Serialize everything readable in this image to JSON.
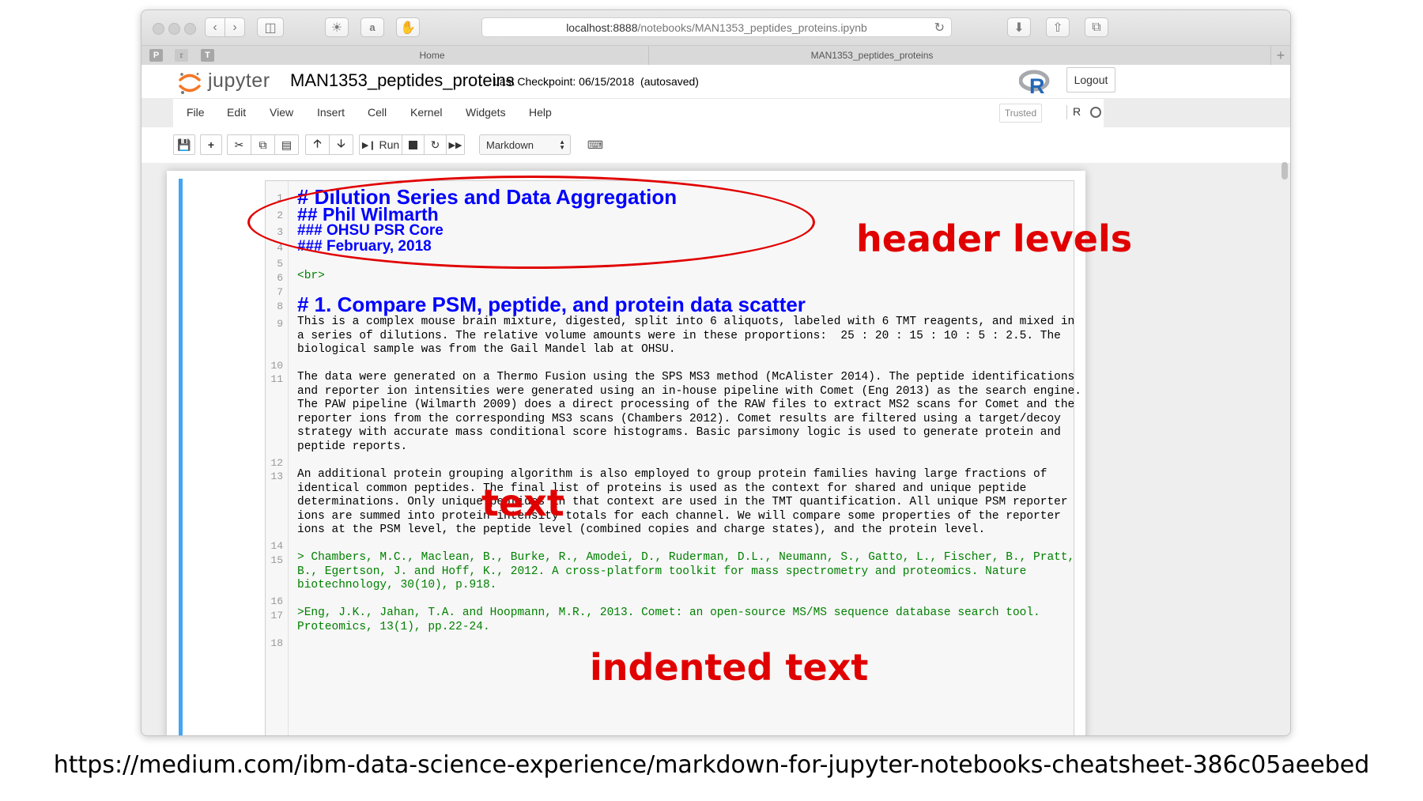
{
  "browser": {
    "url_host": "localhost:8888",
    "url_path": "/notebooks/MAN1353_peptides_proteins.ipynb",
    "tabs": [
      {
        "label": "Home"
      },
      {
        "label": "MAN1353_peptides_proteins"
      }
    ],
    "favorites": [
      "P",
      "T"
    ]
  },
  "jupyter": {
    "logo_text": "jupyter",
    "notebook_name": "MAN1353_peptides_proteins",
    "checkpoint": "Last Checkpoint: 06/15/2018",
    "autosave": "(autosaved)",
    "logout_label": "Logout",
    "kernel_logo": "R",
    "trusted_label": "Trusted",
    "kernel_indicator": "R"
  },
  "menu": [
    "File",
    "Edit",
    "View",
    "Insert",
    "Cell",
    "Kernel",
    "Widgets",
    "Help"
  ],
  "toolbar": {
    "run_label": "Run",
    "cell_type": "Markdown"
  },
  "cell": {
    "line_numbers": [
      "1",
      "2",
      "3",
      "4",
      "5",
      "6",
      "7",
      "8",
      "9",
      "10",
      "11",
      "12",
      "13",
      "14",
      "15",
      "16",
      "17",
      "18"
    ],
    "lines": {
      "l1": "# Dilution Series and Data Aggregation",
      "l2": "## Phil Wilmarth",
      "l3": "### OHSU PSR Core",
      "l4": "### February, 2018",
      "l6": "<br>",
      "l8": "# 1. Compare PSM, peptide, and protein data scatter",
      "p9": [
        "This is a complex mouse brain mixture, digested, split into 6 aliquots, labeled with 6 TMT reagents, and mixed in",
        "a series of dilutions. The relative volume amounts were in these proportions:  25 : 20 : 15 : 10 : 5 : 2.5. The",
        "biological sample was from the Gail Mandel lab at OHSU."
      ],
      "p11": [
        "The data were generated on a Thermo Fusion using the SPS MS3 method (McAlister 2014). The peptide identifications",
        "and reporter ion intensities were generated using an in-house pipeline with Comet (Eng 2013) as the search engine.",
        "The PAW pipeline (Wilmarth 2009) does a direct processing of the RAW files to extract MS2 scans for Comet and the",
        "reporter ions from the corresponding MS3 scans (Chambers 2012). Comet results are filtered using a target/decoy",
        "strategy with accurate mass conditional score histograms. Basic parsimony logic is used to generate protein and",
        "peptide reports."
      ],
      "p13": [
        "An additional protein grouping algorithm is also employed to group protein families having large fractions of",
        "identical common peptides. The final list of proteins is used as the context for shared and unique peptide",
        "determinations. Only unique peptides in that context are used in the TMT quantification. All unique PSM reporter",
        "ions are summed into protein intensity totals for each channel. We will compare some properties of the reporter",
        "ions at the PSM level, the peptide level (combined copies and charge states), and the protein level."
      ],
      "p15": [
        "> Chambers, M.C., Maclean, B., Burke, R., Amodei, D., Ruderman, D.L., Neumann, S., Gatto, L., Fischer, B., Pratt,",
        "B., Egertson, J. and Hoff, K., 2012. A cross-platform toolkit for mass spectrometry and proteomics. Nature",
        "biotechnology, 30(10), p.918."
      ],
      "p17": [
        ">Eng, J.K., Jahan, T.A. and Hoopmann, M.R., 2013. Comet: an open-source MS/MS sequence database search tool.",
        "Proteomics, 13(1), pp.22-24."
      ]
    }
  },
  "annotations": {
    "header_levels": "header levels",
    "text": "text",
    "indented_text": "indented text"
  },
  "caption": "https://medium.com/ibm-data-science-experience/markdown-for-jupyter-notebooks-cheatsheet-386c05aeebed"
}
